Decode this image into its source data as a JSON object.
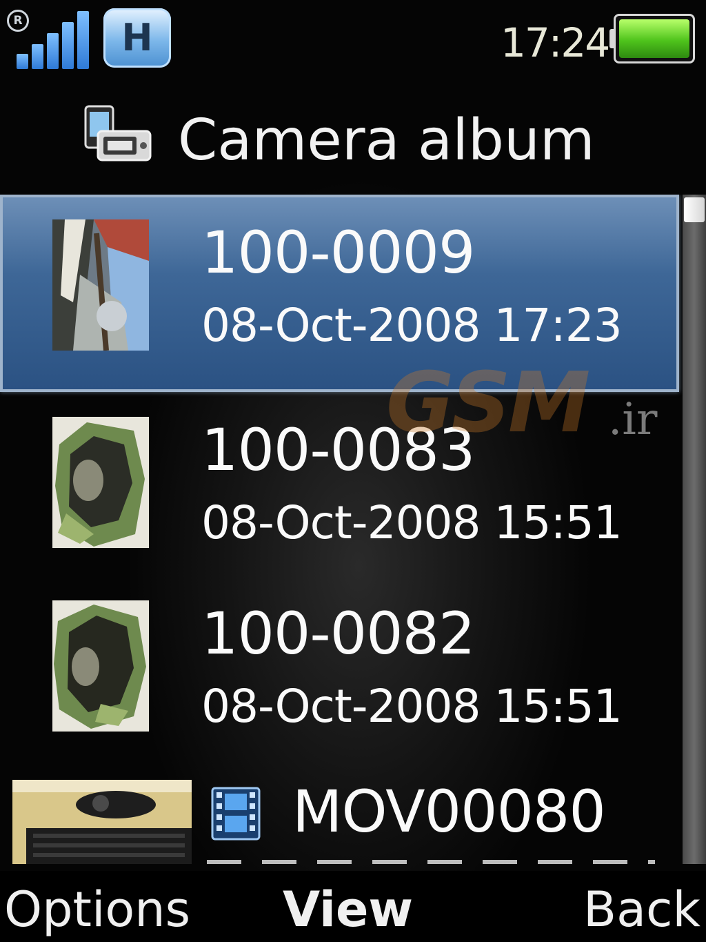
{
  "status_bar": {
    "signal_icon": "signal-strength-icon",
    "network_icon": "hsdpa-icon",
    "network_label": "H",
    "time": "17:24",
    "battery_icon": "battery-icon",
    "battery_level": 0.95,
    "colors": {
      "signal": "#3d8ae6",
      "battery": "#5fd324"
    }
  },
  "header": {
    "icon": "camera-album-icon",
    "title": "Camera album"
  },
  "list": {
    "selected_index": 0,
    "selection_color": "#3e6797",
    "items": [
      {
        "name": "100-0009",
        "date": "08-Oct-2008 17:23",
        "type": "photo"
      },
      {
        "name": "100-0083",
        "date": "08-Oct-2008 15:51",
        "type": "photo"
      },
      {
        "name": "100-0082",
        "date": "08-Oct-2008 15:51",
        "type": "photo"
      },
      {
        "name": "MOV00080",
        "type": "video",
        "icon": "video-file-icon"
      }
    ]
  },
  "watermark": {
    "main": "GSM",
    "suffix": ".ir"
  },
  "softkeys": {
    "left": "Options",
    "center": "View",
    "right": "Back"
  }
}
